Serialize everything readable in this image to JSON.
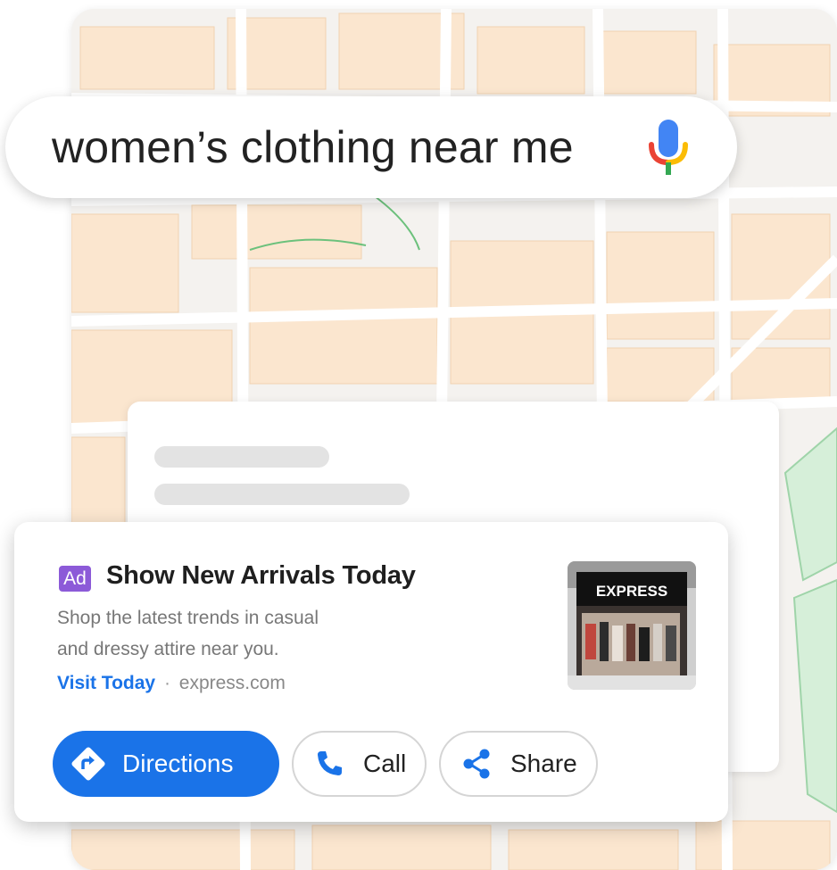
{
  "search": {
    "query": "women’s clothing near me",
    "mic_icon": "microphone-icon"
  },
  "ad": {
    "badge": "Ad",
    "title": "Show New Arrivals Today",
    "description_line1": "Shop the latest trends in casual",
    "description_line2": "and dressy attire near you.",
    "link_text": "Visit Today",
    "separator": "·",
    "domain": "express.com",
    "thumbnail_store_sign": "EXPRESS"
  },
  "actions": {
    "directions_label": "Directions",
    "call_label": "Call",
    "share_label": "Share"
  },
  "colors": {
    "primary_blue": "#1a73e8",
    "ad_badge_purple": "#8c5ad8",
    "map_building": "#fbe7cf",
    "map_park": "#cfe9d4"
  }
}
